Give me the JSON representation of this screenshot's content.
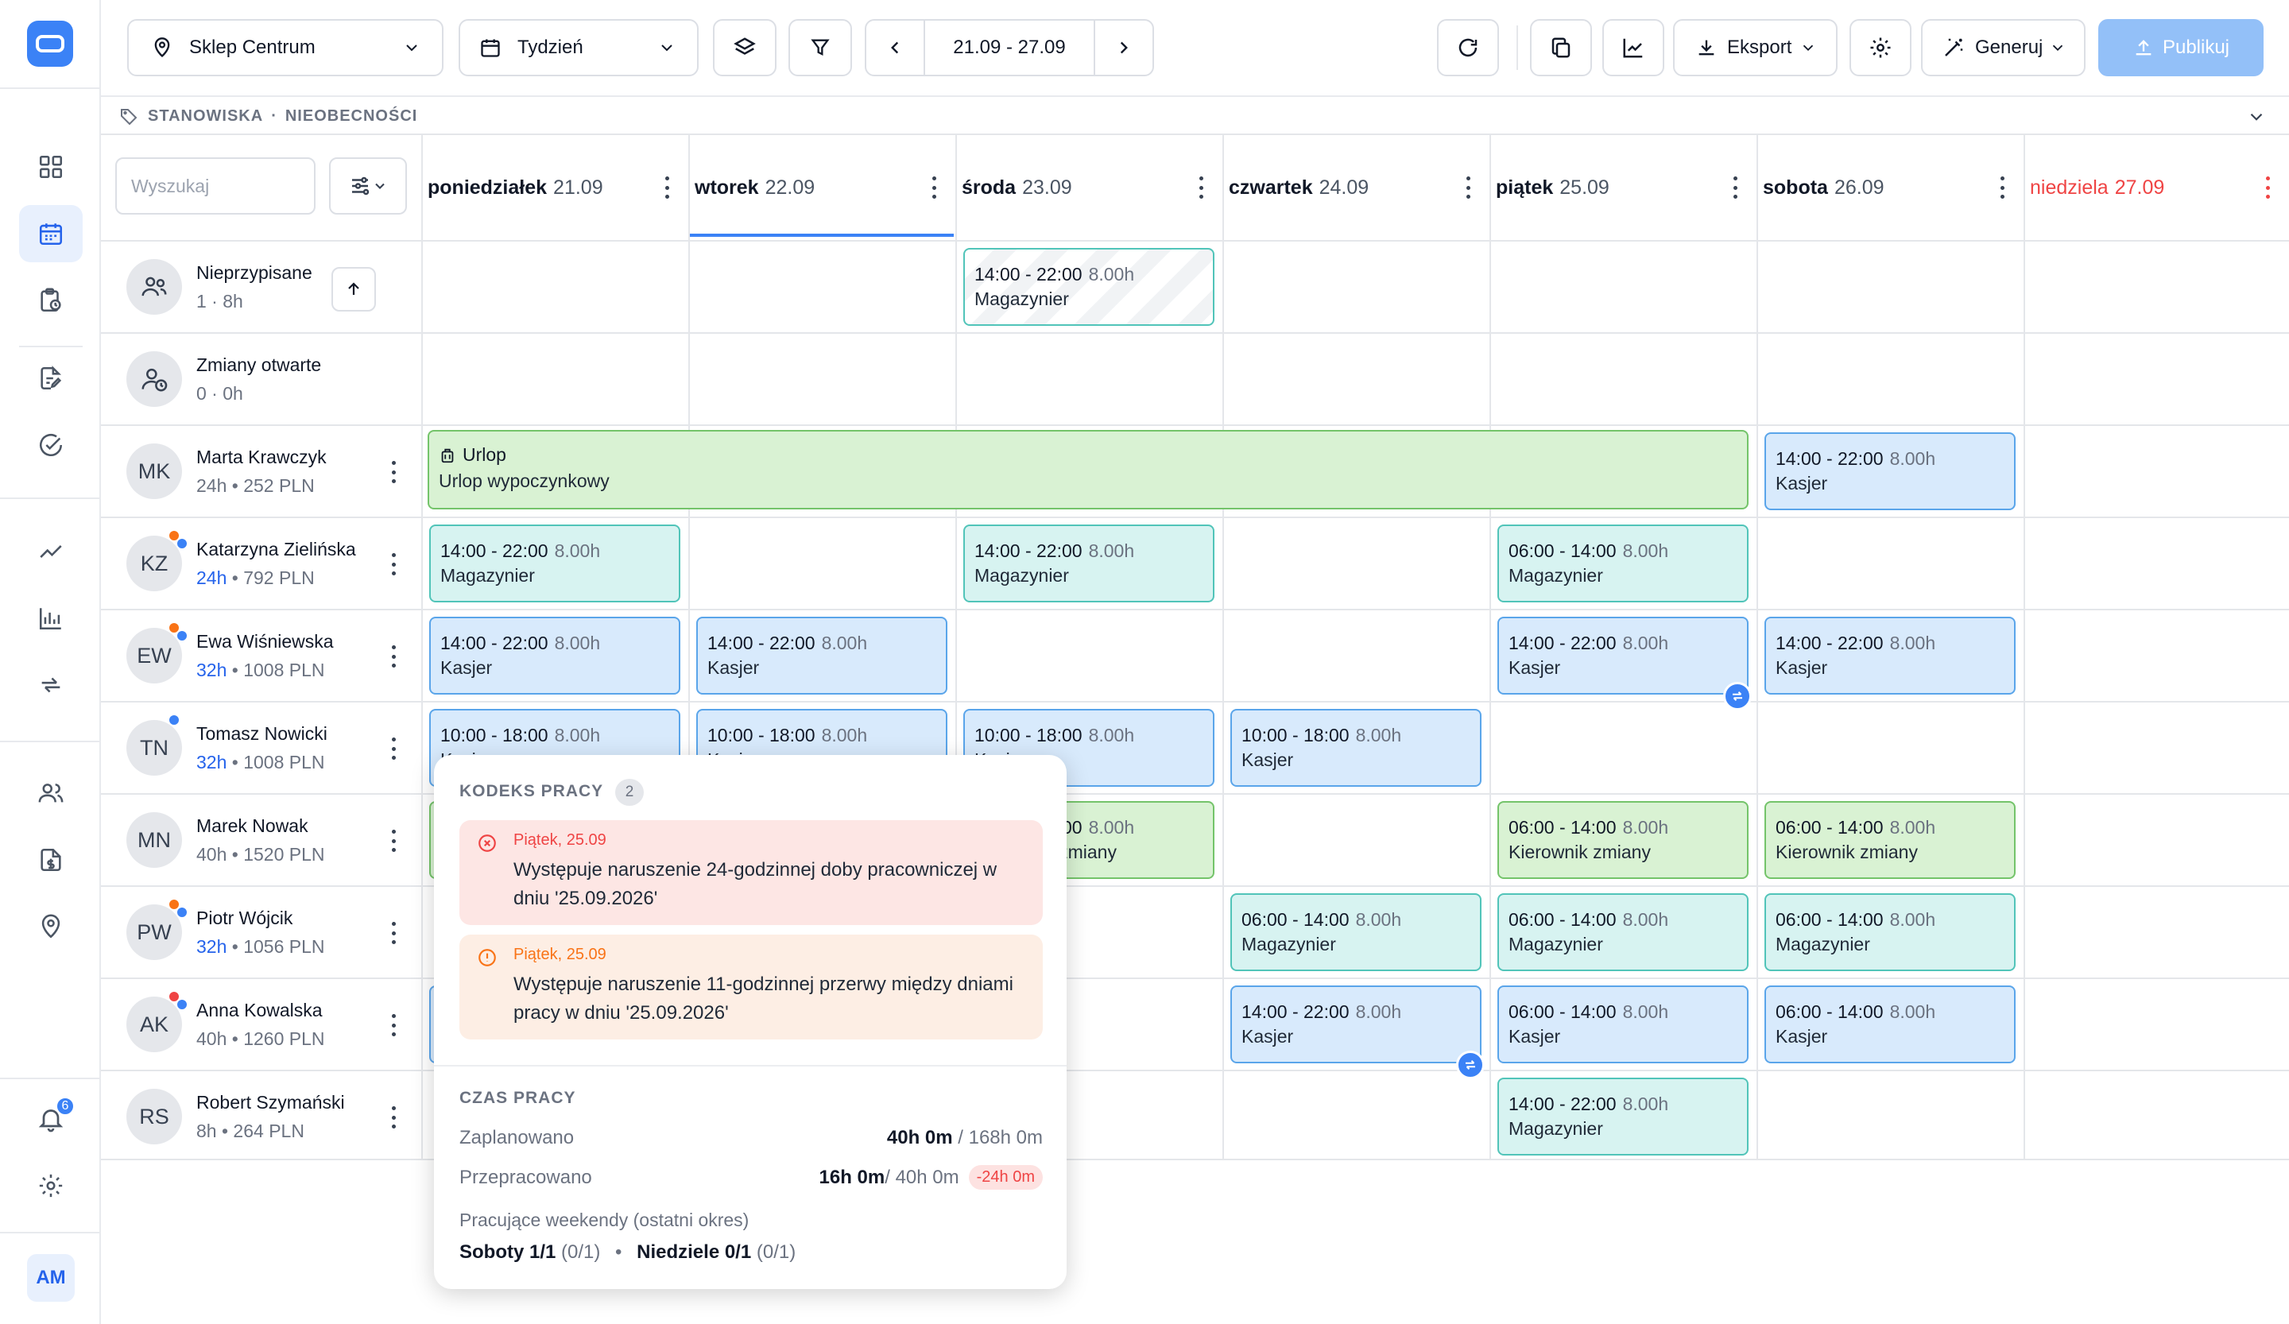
{
  "colors": {
    "accent": "#3b82f6",
    "danger": "#ef4444",
    "teal": "#51c4b9",
    "blue": "#5aa5ea",
    "green": "#74c46a"
  },
  "sidebar": {
    "icons": [
      "grid-icon",
      "calendar-icon",
      "clipboard-clock-icon",
      "document-edit-icon",
      "check-circle-icon",
      "trend-icon",
      "bar-chart-icon",
      "swap-icon",
      "users-icon",
      "money-doc-icon",
      "location-icon"
    ],
    "notif_count": "6",
    "user_initials": "AM"
  },
  "toolbar": {
    "store": "Sklep Centrum",
    "period": "Tydzień",
    "date_range": "21.09 - 27.09",
    "export": "Eksport",
    "generate": "Generuj",
    "publish": "Publikuj"
  },
  "breadcrumb": {
    "a": "STANOWISKA",
    "sep": "·",
    "b": "NIEOBECNOŚCI"
  },
  "search": {
    "placeholder": "Wyszukaj"
  },
  "days": [
    {
      "name": "poniedziałek",
      "date": "21.09"
    },
    {
      "name": "wtorek",
      "date": "22.09"
    },
    {
      "name": "środa",
      "date": "23.09"
    },
    {
      "name": "czwartek",
      "date": "24.09"
    },
    {
      "name": "piątek",
      "date": "25.09"
    },
    {
      "name": "sobota",
      "date": "26.09"
    },
    {
      "name": "niedziela",
      "date": "27.09"
    }
  ],
  "rows": [
    {
      "name": "Nieprzypisane",
      "sub": "1 · 8h"
    },
    {
      "name": "Zmiany otwarte",
      "sub": "0 · 0h"
    },
    {
      "initials": "MK",
      "name": "Marta Krawczyk",
      "hours": "24h",
      "rest": " • 252 PLN"
    },
    {
      "initials": "KZ",
      "name": "Katarzyna Zielińska",
      "hours": "24h",
      "rest": " • 792 PLN"
    },
    {
      "initials": "EW",
      "name": "Ewa Wiśniewska",
      "hours": "32h",
      "rest": " • 1008 PLN"
    },
    {
      "initials": "TN",
      "name": "Tomasz Nowicki",
      "hours": "32h",
      "rest": " • 1008 PLN"
    },
    {
      "initials": "MN",
      "name": "Marek Nowak",
      "hours": "40h",
      "rest": " • 1520 PLN"
    },
    {
      "initials": "PW",
      "name": "Piotr Wójcik",
      "hours": "32h",
      "rest": " • 1056 PLN"
    },
    {
      "initials": "AK",
      "name": "Anna Kowalska",
      "hours": "40h",
      "rest": " • 1260 PLN"
    },
    {
      "initials": "RS",
      "name": "Robert Szymański",
      "hours": "8h",
      "rest": " • 264 PLN"
    }
  ],
  "leave": {
    "title": "Urlop",
    "type": "Urlop wypoczynkowy"
  },
  "shifts": [
    {
      "row": 0,
      "day": 2,
      "time": "14:00 - 22:00",
      "hours": "8.00h",
      "role": "Magazynier",
      "color": "teal"
    },
    {
      "row": 2,
      "day": 5,
      "time": "14:00 - 22:00",
      "hours": "8.00h",
      "role": "Kasjer",
      "color": "blue"
    },
    {
      "row": 3,
      "day": 0,
      "time": "14:00 - 22:00",
      "hours": "8.00h",
      "role": "Magazynier",
      "color": "teal"
    },
    {
      "row": 3,
      "day": 2,
      "time": "14:00 - 22:00",
      "hours": "8.00h",
      "role": "Magazynier",
      "color": "teal"
    },
    {
      "row": 3,
      "day": 4,
      "time": "06:00 - 14:00",
      "hours": "8.00h",
      "role": "Magazynier",
      "color": "teal"
    },
    {
      "row": 4,
      "day": 0,
      "time": "14:00 - 22:00",
      "hours": "8.00h",
      "role": "Kasjer",
      "color": "blue"
    },
    {
      "row": 4,
      "day": 1,
      "time": "14:00 - 22:00",
      "hours": "8.00h",
      "role": "Kasjer",
      "color": "blue"
    },
    {
      "row": 4,
      "day": 4,
      "time": "14:00 - 22:00",
      "hours": "8.00h",
      "role": "Kasjer",
      "color": "blue",
      "swap": true
    },
    {
      "row": 4,
      "day": 5,
      "time": "14:00 - 22:00",
      "hours": "8.00h",
      "role": "Kasjer",
      "color": "blue"
    },
    {
      "row": 5,
      "day": 0,
      "time": "10:00 - 18:00",
      "hours": "8.00h",
      "role": "Kasjer",
      "color": "blue"
    },
    {
      "row": 5,
      "day": 1,
      "time": "10:00 - 18:00",
      "hours": "8.00h",
      "role": "Kasjer",
      "color": "blue"
    },
    {
      "row": 5,
      "day": 2,
      "time": "10:00 - 18:00",
      "hours": "8.00h",
      "role": "Kasjer",
      "color": "blue"
    },
    {
      "row": 5,
      "day": 3,
      "time": "10:00 - 18:00",
      "hours": "8.00h",
      "role": "Kasjer",
      "color": "blue"
    },
    {
      "row": 6,
      "day": 0,
      "time": "",
      "hours": "",
      "role": "",
      "color": "green"
    },
    {
      "row": 6,
      "day": 2,
      "time": "14:00 - 22:00",
      "hours": "8.00h",
      "role": "Kierownik zmiany",
      "color": "green"
    },
    {
      "row": 6,
      "day": 4,
      "time": "06:00 - 14:00",
      "hours": "8.00h",
      "role": "Kierownik zmiany",
      "color": "green"
    },
    {
      "row": 6,
      "day": 5,
      "time": "06:00 - 14:00",
      "hours": "8.00h",
      "role": "Kierownik zmiany",
      "color": "green"
    },
    {
      "row": 7,
      "day": 3,
      "time": "06:00 - 14:00",
      "hours": "8.00h",
      "role": "Magazynier",
      "color": "teal"
    },
    {
      "row": 7,
      "day": 4,
      "time": "06:00 - 14:00",
      "hours": "8.00h",
      "role": "Magazynier",
      "color": "teal"
    },
    {
      "row": 7,
      "day": 5,
      "time": "06:00 - 14:00",
      "hours": "8.00h",
      "role": "Magazynier",
      "color": "teal"
    },
    {
      "row": 8,
      "day": 0,
      "time": "",
      "hours": "",
      "role": "",
      "color": "blue"
    },
    {
      "row": 8,
      "day": 3,
      "time": "14:00 - 22:00",
      "hours": "8.00h",
      "role": "Kasjer",
      "color": "blue",
      "swap": true
    },
    {
      "row": 8,
      "day": 4,
      "time": "06:00 - 14:00",
      "hours": "8.00h",
      "role": "Kasjer",
      "color": "blue"
    },
    {
      "row": 8,
      "day": 5,
      "time": "06:00 - 14:00",
      "hours": "8.00h",
      "role": "Kasjer",
      "color": "blue"
    },
    {
      "row": 9,
      "day": 4,
      "time": "14:00 - 22:00",
      "hours": "8.00h",
      "role": "Magazynier",
      "color": "teal"
    }
  ],
  "popup": {
    "section1": "KODEKS PRACY",
    "count": "2",
    "alerts": [
      {
        "date": "Piątek, 25.09",
        "text": "Występuje naruszenie 24-godzinnej doby pracowniczej w dniu '25.09.2026'",
        "level": "error"
      },
      {
        "date": "Piątek, 25.09",
        "text": "Występuje naruszenie 11-godzinnej przerwy między dniami pracy w dniu '25.09.2026'",
        "level": "warning"
      }
    ],
    "section2": "CZAS PRACY",
    "planned_label": "Zaplanowano",
    "planned_value": "40h 0m",
    "planned_total": " / 168h 0m",
    "worked_label": "Przepracowano",
    "worked_value": "16h 0m",
    "worked_total": " / 40h 0m",
    "worked_diff": "-24h 0m",
    "weekends_label": "Pracujące weekendy (ostatni okres)",
    "saturdays": "Soboty 1/1",
    "saturdays_sub": " (0/1)",
    "sep": "•",
    "sundays": "Niedziele 0/1",
    "sundays_sub": " (0/1)"
  }
}
